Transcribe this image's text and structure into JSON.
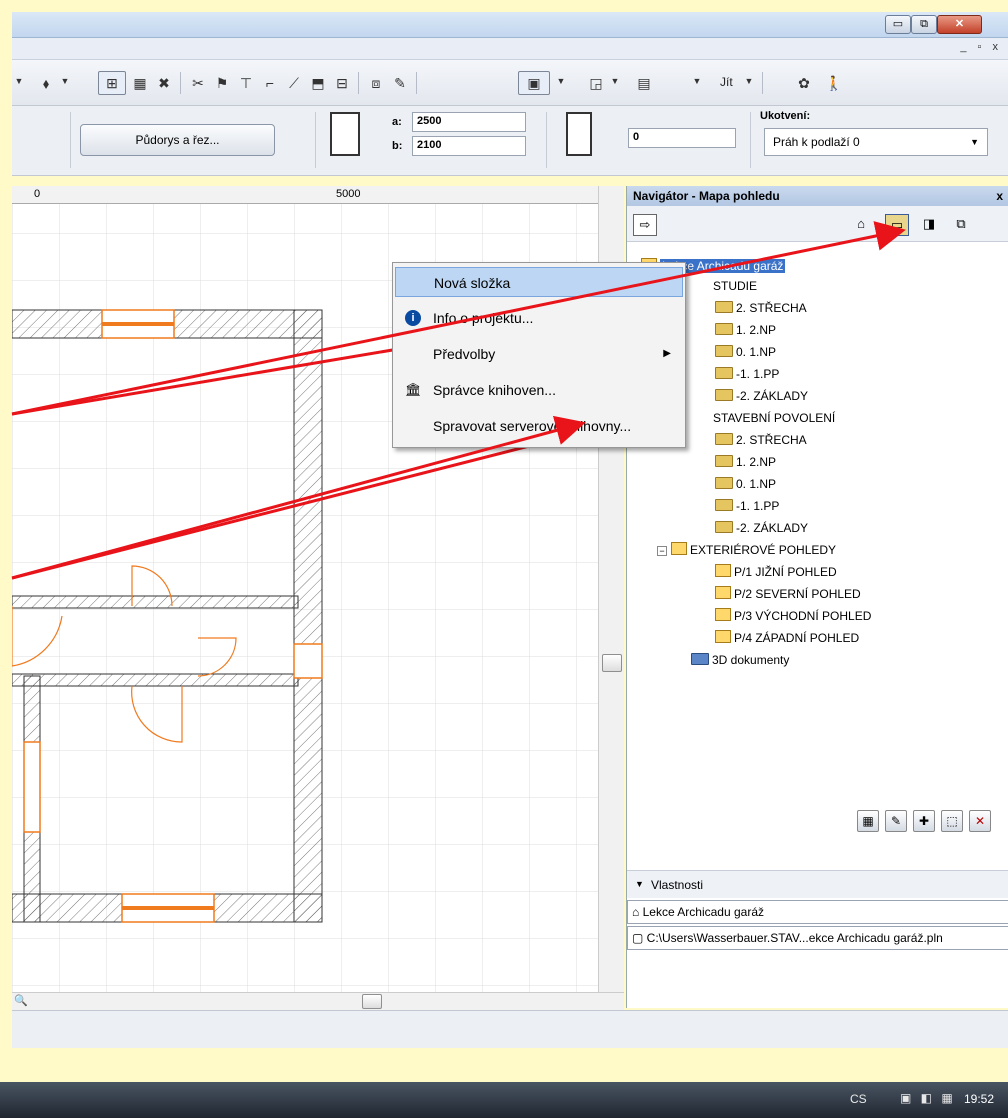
{
  "window": {
    "minimize_glyph": "▭",
    "maximize_glyph": "⧉",
    "close_glyph": "✕",
    "mdi_controls": "_ ▫ x"
  },
  "toolbar": {
    "jit_label": "Jít",
    "drop_glyph": "▼"
  },
  "infobox": {
    "plan_section_button": "Půdorys a řez...",
    "a_label": "a:",
    "a_value": "2500",
    "b_label": "b:",
    "b_value": "2100",
    "offset_value": "0",
    "anchor_title": "Ukotvení:",
    "anchor_value": "Práh k podlaží 0"
  },
  "ruler": {
    "ticks": [
      "0",
      "5000"
    ]
  },
  "navigator": {
    "title": "Navigátor - Mapa pohledu",
    "close_glyph": "x",
    "tree": [
      {
        "label": "Lekce Archicadu garáž",
        "kind": "root"
      },
      {
        "label": "STUDIE",
        "kind": "folder"
      },
      {
        "label": "2. STŘECHA",
        "kind": "story"
      },
      {
        "label": "1. 2.NP",
        "kind": "story"
      },
      {
        "label": "0. 1.NP",
        "kind": "story"
      },
      {
        "label": "-1. 1.PP",
        "kind": "story"
      },
      {
        "label": "-2. ZÁKLADY",
        "kind": "story"
      },
      {
        "label": "STAVEBNÍ POVOLENÍ",
        "kind": "folder"
      },
      {
        "label": "2. STŘECHA",
        "kind": "story"
      },
      {
        "label": "1. 2.NP",
        "kind": "story"
      },
      {
        "label": "0. 1.NP",
        "kind": "story"
      },
      {
        "label": "-1. 1.PP",
        "kind": "story"
      },
      {
        "label": "-2. ZÁKLADY",
        "kind": "story"
      },
      {
        "label": "EXTERIÉROVÉ POHLEDY",
        "kind": "group"
      },
      {
        "label": "P/1 JIŽNÍ POHLED",
        "kind": "elevation"
      },
      {
        "label": "P/2 SEVERNÍ POHLED",
        "kind": "elevation"
      },
      {
        "label": "P/3 VÝCHODNÍ POHLED",
        "kind": "elevation"
      },
      {
        "label": "P/4 ZÁPADNÍ POHLED",
        "kind": "elevation"
      },
      {
        "label": "3D dokumenty",
        "kind": "doc3d"
      }
    ],
    "properties_label": "Vlastnosti",
    "property_name": "Lekce Archicadu garáž",
    "property_path": "C:\\Users\\Wasserbauer.STAV...ekce Archicadu garáž.pln"
  },
  "context_menu": {
    "items": [
      {
        "label": "Nová složka"
      },
      {
        "label": "Info o projektu..."
      },
      {
        "label": "Předvolby"
      },
      {
        "label": "Správce knihoven..."
      },
      {
        "label": "Spravovat serverové knihovny..."
      }
    ],
    "submenu_arrow": "▶"
  },
  "taskbar": {
    "language": "CS",
    "clock": "19:52"
  },
  "colors": {
    "slide_background": "#fffac8",
    "annotation_arrow": "#e8141a",
    "wall_hatch": "#555555",
    "opening_orange": "#f07a1e",
    "selection_blue": "#3b72c9",
    "menu_highlight": "#bcd6f4"
  }
}
